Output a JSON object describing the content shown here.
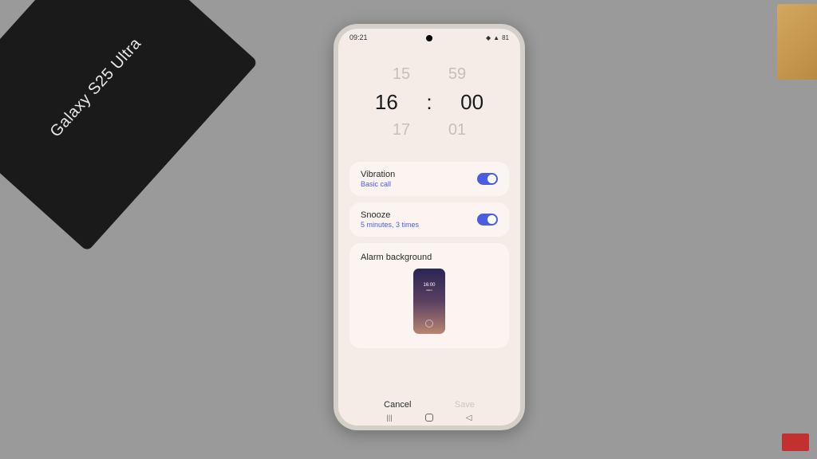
{
  "box_label": "Galaxy S25 Ultra",
  "statusbar": {
    "time": "09:21",
    "right": "81"
  },
  "time_picker": {
    "prev_hour": "15",
    "prev_min": "59",
    "hour": "16",
    "separator": ":",
    "minute": "00",
    "next_hour": "17",
    "next_min": "01"
  },
  "settings": {
    "vibration": {
      "title": "Vibration",
      "sub": "Basic call",
      "enabled": true
    },
    "snooze": {
      "title": "Snooze",
      "sub": "5 minutes, 3 times",
      "enabled": true
    },
    "background": {
      "title": "Alarm background",
      "preview_time": "16:00"
    }
  },
  "bottom": {
    "cancel": "Cancel",
    "save": "Save"
  }
}
